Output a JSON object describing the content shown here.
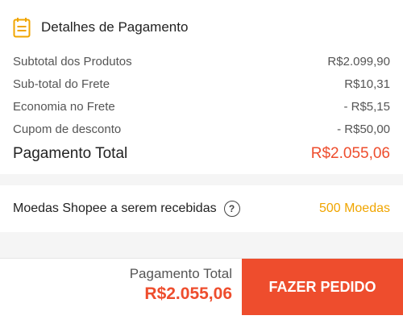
{
  "payment_details": {
    "title": "Detalhes de Pagamento",
    "icon": "receipt-icon",
    "accent_color": "#f0a500",
    "rows": [
      {
        "label": "Subtotal dos Produtos",
        "value": "R$2.099,90"
      },
      {
        "label": "Sub-total do Frete",
        "value": "R$10,31"
      },
      {
        "label": "Economia no Frete",
        "value": "- R$5,15"
      },
      {
        "label": "Cupom de desconto",
        "value": "- R$50,00"
      }
    ],
    "total": {
      "label": "Pagamento Total",
      "value": "R$2.055,06",
      "color": "#ee4d2d"
    }
  },
  "coins": {
    "label": "Moedas Shopee a serem recebidas",
    "help_icon": "question-circle-icon",
    "help_glyph": "?",
    "value": "500 Moedas",
    "color": "#f0a500"
  },
  "bottom_bar": {
    "total_label": "Pagamento Total",
    "total_value": "R$2.055,06",
    "order_button": "FAZER PEDIDO",
    "button_color": "#ee4d2d"
  }
}
